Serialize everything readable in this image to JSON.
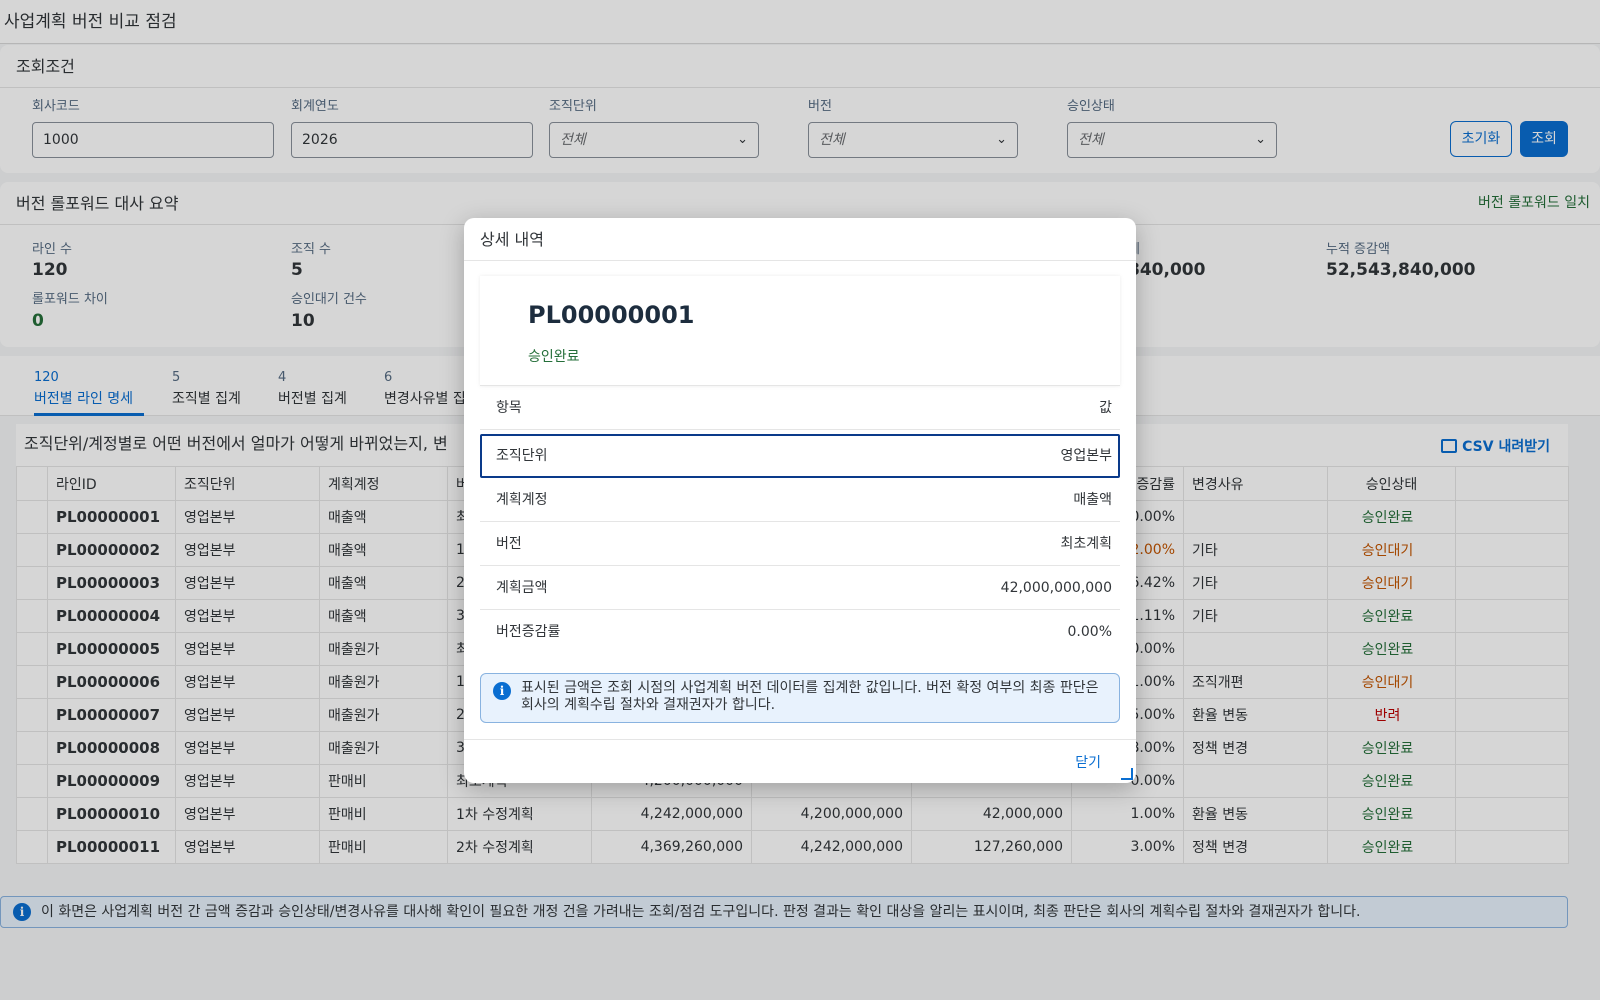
{
  "page_title": "사업계획 버전 비교 점검",
  "filter": {
    "heading": "조회조건",
    "company_label": "회사코드",
    "company_value": "1000",
    "year_label": "회계연도",
    "year_value": "2026",
    "org_label": "조직단위",
    "org_value": "전체",
    "version_label": "버전",
    "version_value": "전체",
    "approval_label": "승인상태",
    "approval_value": "전체",
    "reset_label": "초기화",
    "search_label": "조회"
  },
  "summary": {
    "heading": "버전 롤포워드 대사 요약",
    "status": "버전 롤포워드 일치",
    "lines_label": "라인 수",
    "lines_value": "120",
    "orgs_label": "조직 수",
    "orgs_value": "5",
    "rollforward_label": "롤포워드 차이",
    "rollforward_value": "0",
    "pending_label": "승인대기 건수",
    "pending_value": "10",
    "total_label_partial": "계",
    "total_value_partial": "840,000",
    "cum_label": "누적 증감액",
    "cum_value": "52,543,840,000"
  },
  "tabs": [
    {
      "count": "120",
      "label": "버전별 라인 명세"
    },
    {
      "count": "5",
      "label": "조직별 집계"
    },
    {
      "count": "4",
      "label": "버전별 집계"
    },
    {
      "count": "6",
      "label": "변경사유별 집"
    }
  ],
  "table": {
    "description": "조직단위/계정별로 어떤 버전에서 얼마가 어떻게 바뀌었는지, 변",
    "csv_label": "CSV 내려받기",
    "headers": [
      "",
      "라인ID",
      "조직단위",
      "계획계정",
      "버",
      "",
      "",
      "",
      "증감률",
      "변경사유",
      "승인상태",
      ""
    ],
    "rows": [
      {
        "id": "PL00000001",
        "org": "영업본부",
        "account": "매출액",
        "version": "최",
        "amount": "",
        "prev": "",
        "diff": "",
        "rate": "0.00%",
        "reason": "",
        "status": "승인완료"
      },
      {
        "id": "PL00000002",
        "org": "영업본부",
        "account": "매출액",
        "version": "1",
        "amount": "",
        "prev": "",
        "diff": "",
        "rate": "2.00%",
        "reason": "기타",
        "status": "승인대기"
      },
      {
        "id": "PL00000003",
        "org": "영업본부",
        "account": "매출액",
        "version": "2",
        "amount": "",
        "prev": "",
        "diff": "",
        "rate": "6.42%",
        "reason": "기타",
        "status": "승인대기"
      },
      {
        "id": "PL00000004",
        "org": "영업본부",
        "account": "매출액",
        "version": "3",
        "amount": "",
        "prev": "",
        "diff": "",
        "rate": "1.11%",
        "reason": "기타",
        "status": "승인완료"
      },
      {
        "id": "PL00000005",
        "org": "영업본부",
        "account": "매출원가",
        "version": "최",
        "amount": "",
        "prev": "",
        "diff": "",
        "rate": "0.00%",
        "reason": "",
        "status": "승인완료"
      },
      {
        "id": "PL00000006",
        "org": "영업본부",
        "account": "매출원가",
        "version": "1",
        "amount": "",
        "prev": "",
        "diff": "",
        "rate": "1.00%",
        "reason": "조직개편",
        "status": "승인대기"
      },
      {
        "id": "PL00000007",
        "org": "영업본부",
        "account": "매출원가",
        "version": "2",
        "amount": "",
        "prev": "",
        "diff": "",
        "rate": "5.00%",
        "reason": "환율 변동",
        "status": "반려"
      },
      {
        "id": "PL00000008",
        "org": "영업본부",
        "account": "매출원가",
        "version": "3",
        "amount": "",
        "prev": "",
        "diff": "",
        "rate": "8.00%",
        "reason": "정책 변경",
        "status": "승인완료"
      },
      {
        "id": "PL00000009",
        "org": "영업본부",
        "account": "판매비",
        "version": "최초계획",
        "amount": "4,200,000,000",
        "prev": "",
        "diff": "",
        "rate": "0.00%",
        "reason": "",
        "status": "승인완료"
      },
      {
        "id": "PL00000010",
        "org": "영업본부",
        "account": "판매비",
        "version": "1차 수정계획",
        "amount": "4,242,000,000",
        "prev": "4,200,000,000",
        "diff": "42,000,000",
        "rate": "1.00%",
        "reason": "환율 변동",
        "status": "승인완료"
      },
      {
        "id": "PL00000011",
        "org": "영업본부",
        "account": "판매비",
        "version": "2차 수정계획",
        "amount": "4,369,260,000",
        "prev": "4,242,000,000",
        "diff": "127,260,000",
        "rate": "3.00%",
        "reason": "정책 변경",
        "status": "승인완료"
      }
    ]
  },
  "info_bar": "이 화면은 사업계획 버전 간 금액 증감과 승인상태/변경사유를 대사해 확인이 필요한 개정 건을 가려내는 조회/점검 도구입니다. 판정 결과는 확인 대상을 알리는 표시이며, 최종 판단은 회사의 계획수립 절차와 결재권자가 합니다.",
  "dialog": {
    "title": "상세 내역",
    "id": "PL00000001",
    "status": "승인완료",
    "col_key": "항목",
    "col_value": "값",
    "rows": [
      {
        "k": "조직단위",
        "v": "영업본부"
      },
      {
        "k": "계획계정",
        "v": "매출액"
      },
      {
        "k": "버전",
        "v": "최초계획"
      },
      {
        "k": "계획금액",
        "v": "42,000,000,000"
      },
      {
        "k": "버전증감률",
        "v": "0.00%"
      }
    ],
    "note": "표시된 금액은 조회 시점의 사업계획 버전 데이터를 집계한 값입니다. 버전 확정 여부의 최종 판단은 회사의 계획수립 절차와 결재권자가 합니다.",
    "close_label": "닫기"
  },
  "colors": {
    "accent": "#0a6ed1",
    "success": "#256f3a",
    "warning": "#c35500",
    "error": "#bb0000"
  }
}
